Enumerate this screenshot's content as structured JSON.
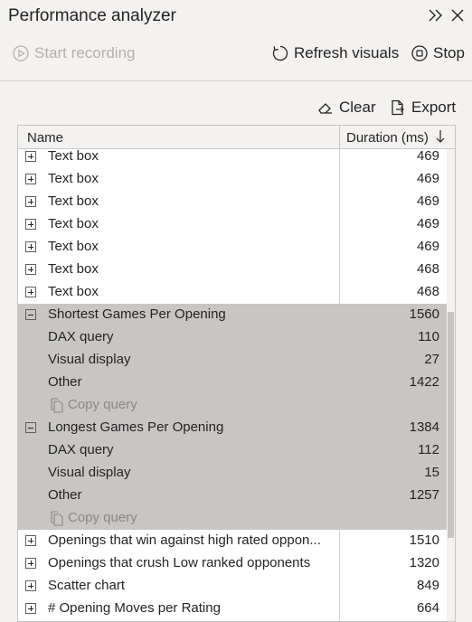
{
  "header": {
    "title": "Performance analyzer",
    "collapse_icon": "double-chevron-right-icon",
    "close_icon": "close-icon"
  },
  "toolbar": {
    "start_recording": "Start recording",
    "refresh_visuals": "Refresh visuals",
    "stop": "Stop"
  },
  "actions": {
    "clear": "Clear",
    "export": "Export"
  },
  "table": {
    "col_name": "Name",
    "col_duration": "Duration (ms)",
    "sort": "descending",
    "rows": [
      {
        "type": "item",
        "name": "Text box",
        "duration": "469",
        "expanded": false
      },
      {
        "type": "item",
        "name": "Text box",
        "duration": "469",
        "expanded": false
      },
      {
        "type": "item",
        "name": "Text box",
        "duration": "469",
        "expanded": false
      },
      {
        "type": "item",
        "name": "Text box",
        "duration": "469",
        "expanded": false
      },
      {
        "type": "item",
        "name": "Text box",
        "duration": "469",
        "expanded": false
      },
      {
        "type": "item",
        "name": "Text box",
        "duration": "468",
        "expanded": false
      },
      {
        "type": "item",
        "name": "Text box",
        "duration": "468",
        "expanded": false
      },
      {
        "type": "item",
        "name": "Shortest Games Per Opening",
        "duration": "1560",
        "expanded": true,
        "selected": true
      },
      {
        "type": "child",
        "name": "DAX query",
        "duration": "110",
        "selected": true
      },
      {
        "type": "child",
        "name": "Visual display",
        "duration": "27",
        "selected": true
      },
      {
        "type": "child",
        "name": "Other",
        "duration": "1422",
        "selected": true
      },
      {
        "type": "copy",
        "name": "Copy query",
        "selected": true
      },
      {
        "type": "item",
        "name": "Longest Games Per Opening",
        "duration": "1384",
        "expanded": true,
        "selected": true
      },
      {
        "type": "child",
        "name": "DAX query",
        "duration": "112",
        "selected": true
      },
      {
        "type": "child",
        "name": "Visual display",
        "duration": "15",
        "selected": true
      },
      {
        "type": "child",
        "name": "Other",
        "duration": "1257",
        "selected": true
      },
      {
        "type": "copy",
        "name": "Copy query",
        "selected": true
      },
      {
        "type": "item",
        "name": "Openings that win against high rated oppon...",
        "duration": "1510",
        "expanded": false
      },
      {
        "type": "item",
        "name": "Openings that crush Low ranked opponents",
        "duration": "1320",
        "expanded": false
      },
      {
        "type": "item",
        "name": "Scatter chart",
        "duration": "849",
        "expanded": false
      },
      {
        "type": "item",
        "name": "# Opening Moves per Rating",
        "duration": "664",
        "expanded": false
      }
    ]
  }
}
